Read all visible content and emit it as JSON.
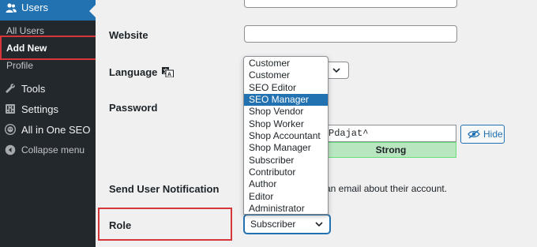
{
  "sidebar": {
    "users_label": "Users",
    "submenu": [
      {
        "label": "All Users"
      },
      {
        "label": "Add New"
      },
      {
        "label": "Profile"
      }
    ],
    "items": [
      {
        "label": "Tools",
        "icon": "wrench-icon"
      },
      {
        "label": "Settings",
        "icon": "settings-icon"
      },
      {
        "label": "All in One SEO",
        "icon": "aioseo-icon"
      },
      {
        "label": "Collapse menu",
        "icon": "collapse-icon"
      }
    ]
  },
  "form": {
    "website_label": "Website",
    "website_value": "",
    "language_label": "Language",
    "password_label": "Password",
    "password_value": "Pdajat^",
    "password_strength": "Strong",
    "hide_label": "Hide",
    "notification_label": "Send User Notification",
    "notification_text": "an email about their account.",
    "role_label": "Role",
    "role_value": "Subscriber"
  },
  "role_dropdown": {
    "options": [
      "Customer",
      "Customer",
      "SEO Editor",
      "SEO Manager",
      "Shop Vendor",
      "Shop Worker",
      "Shop Accountant",
      "Shop Manager",
      "Subscriber",
      "Contributor",
      "Author",
      "Editor",
      "Administrator"
    ],
    "highlighted": "SEO Manager"
  },
  "colors": {
    "sidebar_bg": "#23282d",
    "accent": "#2271b1",
    "highlight_border": "#d63638",
    "strength_bg": "#b8e6bf"
  }
}
